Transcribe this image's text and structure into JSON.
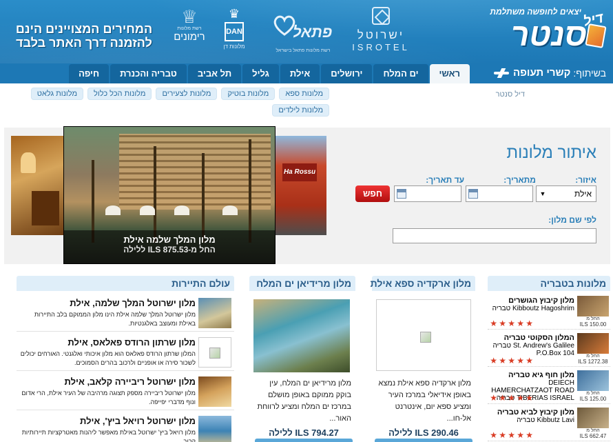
{
  "header": {
    "logo_tagline": "יצאים לחופשה משתלמת",
    "logo_main": "סנטר",
    "logo_deal": "דיל",
    "brands": {
      "isrotel_heb": "ישרוטל",
      "isrotel_lat": "ISROTEL",
      "fattal": "פתאל",
      "fattal_sub": "רשת מלונות פתאל בישראל",
      "dan_box": "DAN",
      "dan_sub": "מלונות דן",
      "rimonim_sub": "רשת מלונות",
      "rimonim": "רימונים"
    },
    "promo_line1": "המחירים המצויינים הינם",
    "promo_line2": "להזמנה דרך האתר בלבד",
    "partner_prefix": "בשיתוף:",
    "partner_name": "קשרי תעופה"
  },
  "nav": {
    "tabs": [
      {
        "label": "ראשי",
        "active": true
      },
      {
        "label": "ים המלח"
      },
      {
        "label": "ירושלים"
      },
      {
        "label": "אילת"
      },
      {
        "label": "גליל"
      },
      {
        "label": "תל אביב"
      },
      {
        "label": "טבריה והכנרת"
      },
      {
        "label": "חיפה"
      }
    ]
  },
  "breadcrumb": "דיל סנטר",
  "sub_links": [
    "מלונות ספא",
    "מלונות בוטיק",
    "מלונות לצעירים",
    "מלונות הכל כלול",
    "מלונות גלאט",
    "מלונות לילדים"
  ],
  "gallery": {
    "caption_title": "מלון המלך שלמה אילת",
    "caption_price": "החל מ-ILS 875.53 ללילה",
    "right_sign": "Ha Rossu"
  },
  "search": {
    "title": "איתור מלונות",
    "region_label": "איזור:",
    "region_value": "אילת",
    "from_label": "מתאריך:",
    "to_label": "עד תאריך:",
    "button_label": "חפש",
    "name_label": "לפי שם מלון:"
  },
  "columns": {
    "tiberias": {
      "title": "מלונות בטבריה",
      "items": [
        {
          "name": "מלון קיבוץ הגושרים",
          "en": "Kibboutz Hagoshrim טבריה",
          "price_label": "החל מ",
          "price": "ILS 150.00"
        },
        {
          "name": "המלון הסקוטי טבריה",
          "en": "St. Andrew's Galilee טבריה P.O.Box 104",
          "price_label": "החל מ",
          "price": "ILS 1272.38"
        },
        {
          "name": "מלון חוף גיא טבריה",
          "en": "DEIECH HAMERCHATZAOT ROAD TIBERIAS ISRAEL טבריה",
          "price_label": "החל מ",
          "price": "ILS 125.00"
        },
        {
          "name": "מלון קיבוץ לביא טבריה",
          "en": "Kibbutz Lavi טבריה",
          "price_label": "החל מ",
          "price": "ILS 662.47"
        }
      ]
    },
    "arkadia": {
      "title": "מלון ארקדיה ספא אילת",
      "desc": "מלון ארקדיה ספא אילת נמצא באופן אידיאלי במרכז העיר ומציע ספא יום, אינטרנט אל-חו...",
      "price": "ILS 290.46",
      "price_suffix": "ללילה"
    },
    "meridian": {
      "title": "מלון מרידיאן ים המלח",
      "desc": "מלון מרידיאן ים המלח, עין בוקק ממוקם באופן מושלם במרכז ים המלח ומציע לרווחת האור...",
      "price": "ILS 794.27",
      "price_suffix": "ללילה"
    },
    "tourism": {
      "title": "עולם התיירות",
      "items": [
        {
          "title": "מלון ישרוטל המלך שלמה, אילת",
          "desc": "מלון ישרוטל המלך שלמה אילת הינו מלון הממוקם בלב התיירות באילת ומעוצב באלגנטיות."
        },
        {
          "title": "מלון שרתון הרודס פאלאס, אילת",
          "desc": "המלון שרתון הרודס פאלאס הוא מלון איכותי ואלגנטי. האורחים יכולים לשכור סירה או אופניים ולרכוב בהרים הסמוכים."
        },
        {
          "title": "מלון ישרוטל ריביירה קלאב, אילת",
          "desc": "מלון ישרוטל ריביירה מספק תצוגה מרהיבה של העיר אילת, הרי אדום ונוף מדברי יפייפה."
        },
        {
          "title": "מלון ישרוטל רויאל ביץ', אילת",
          "desc": "מלון רויאל ביץ' ישרוטל באילת מאפשר ליהנות מאטרקציות תיירותיות קרוב"
        }
      ]
    }
  },
  "colors": {
    "header_blue": "#1d78b5",
    "tab_blue": "#14669e",
    "accent_blue": "#2a7fb8",
    "star_red": "#d93c24",
    "search_red": "#c41616"
  }
}
